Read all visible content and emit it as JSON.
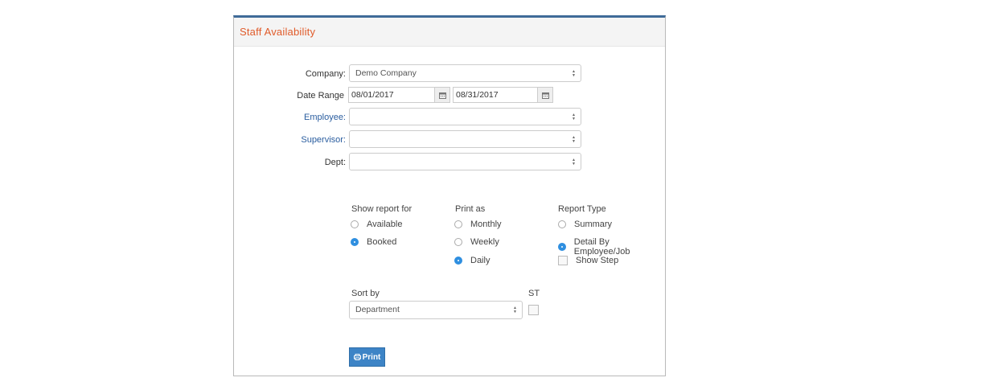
{
  "panel": {
    "title": "Staff Availability"
  },
  "form": {
    "company": {
      "label": "Company:",
      "value": "Demo Company"
    },
    "date_range": {
      "label": "Date Range",
      "from": "08/01/2017",
      "to": "08/31/2017"
    },
    "employee": {
      "label": "Employee:",
      "value": ""
    },
    "supervisor": {
      "label": "Supervisor:",
      "value": ""
    },
    "dept": {
      "label": "Dept:",
      "value": ""
    }
  },
  "show_report_for": {
    "heading": "Show report for",
    "options": [
      {
        "label": "Available",
        "checked": false
      },
      {
        "label": "Booked",
        "checked": true
      }
    ]
  },
  "print_as": {
    "heading": "Print as",
    "options": [
      {
        "label": "Monthly",
        "checked": false
      },
      {
        "label": "Weekly",
        "checked": false
      },
      {
        "label": "Daily",
        "checked": true
      }
    ]
  },
  "report_type": {
    "heading": "Report Type",
    "options": [
      {
        "label": "Summary",
        "checked": false
      },
      {
        "label": "Detail By Employee/Job",
        "checked": true
      }
    ],
    "show_step": {
      "label": "Show Step",
      "checked": false
    }
  },
  "sort": {
    "label": "Sort by",
    "value": "Department"
  },
  "st": {
    "label": "ST",
    "checked": false
  },
  "print_button": {
    "label": "Print"
  },
  "icons": {
    "calendar": "calendar-icon",
    "printer": "printer-icon",
    "caret": "sort-caret-icon"
  }
}
